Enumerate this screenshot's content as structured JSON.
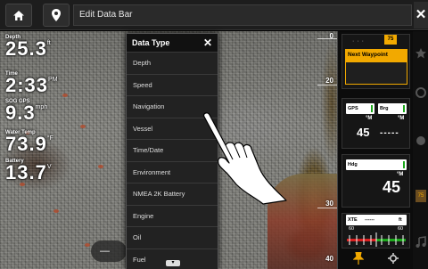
{
  "topbar": {
    "title": "Edit Data Bar",
    "home_icon": "home-icon",
    "waypoint_icon": "waypoint-pin-icon",
    "close": "✕"
  },
  "databar": [
    {
      "label": "Depth",
      "value": "25.3",
      "unit": "ft"
    },
    {
      "label": "Time",
      "value": "2:33",
      "unit": "PM"
    },
    {
      "label": "SOG GPS",
      "value": "9.3",
      "unit": "mph"
    },
    {
      "label": "Water Temp",
      "value": "73.9",
      "unit": "°F"
    },
    {
      "label": "Battery",
      "value": "13.7",
      "unit": "V"
    }
  ],
  "sonar": {
    "scale": [
      "0",
      "20",
      "30",
      "40"
    ]
  },
  "data_type": {
    "title": "Data Type",
    "close": "✕",
    "items": [
      "Depth",
      "Speed",
      "Navigation",
      "Vessel",
      "Time/Date",
      "Environment",
      "NMEA 2K Battery",
      "Engine",
      "Oil",
      "Fuel"
    ],
    "more_icon": "▾"
  },
  "bottom_pill": "—",
  "right_panel": {
    "wp_number": "75",
    "next_waypoint": "Next Waypoint",
    "gps_label": "GPS",
    "brg_label": "Brg",
    "gps_unit": "°M",
    "brg_unit": "°M",
    "gps_value": "45",
    "brg_value": "-----",
    "hdg_label": "Hdg",
    "hdg_unit": "°M",
    "hdg_value": "45",
    "xte_label": "XTE",
    "xte_value": "------",
    "xte_unit": "ft",
    "xte_left": "60",
    "xte_right": "60"
  },
  "colors": {
    "accent": "#f2a900",
    "green": "#1ca81c",
    "red": "#d92020"
  }
}
